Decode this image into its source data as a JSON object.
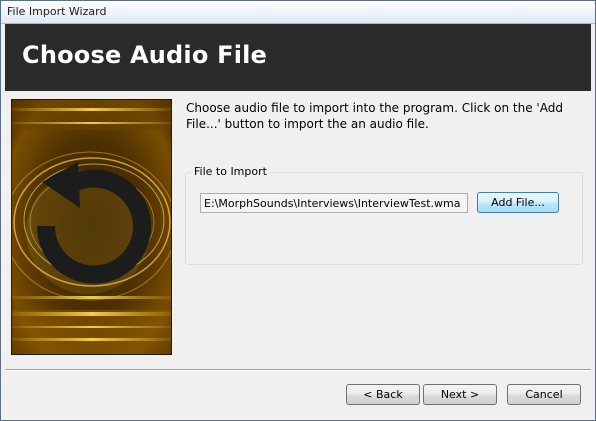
{
  "window": {
    "title": "File Import Wizard"
  },
  "header": {
    "title": "Choose Audio File"
  },
  "content": {
    "instructions": "Choose audio file to import into the program.  Click on the 'Add File...' button to import the an audio file.",
    "side_image": {
      "icon": "circular-arrow-icon",
      "colors": {
        "background": "#1a0d00",
        "glow": "#ffcc33",
        "arrow": "#1c1c1c"
      }
    }
  },
  "file_group": {
    "label": "File to Import",
    "path_value": "E:\\MorphSounds\\Interviews\\InterviewTest.wma",
    "add_button_label": "Add File..."
  },
  "footer": {
    "back_label": "< Back",
    "next_label": "Next >",
    "cancel_label": "Cancel"
  }
}
